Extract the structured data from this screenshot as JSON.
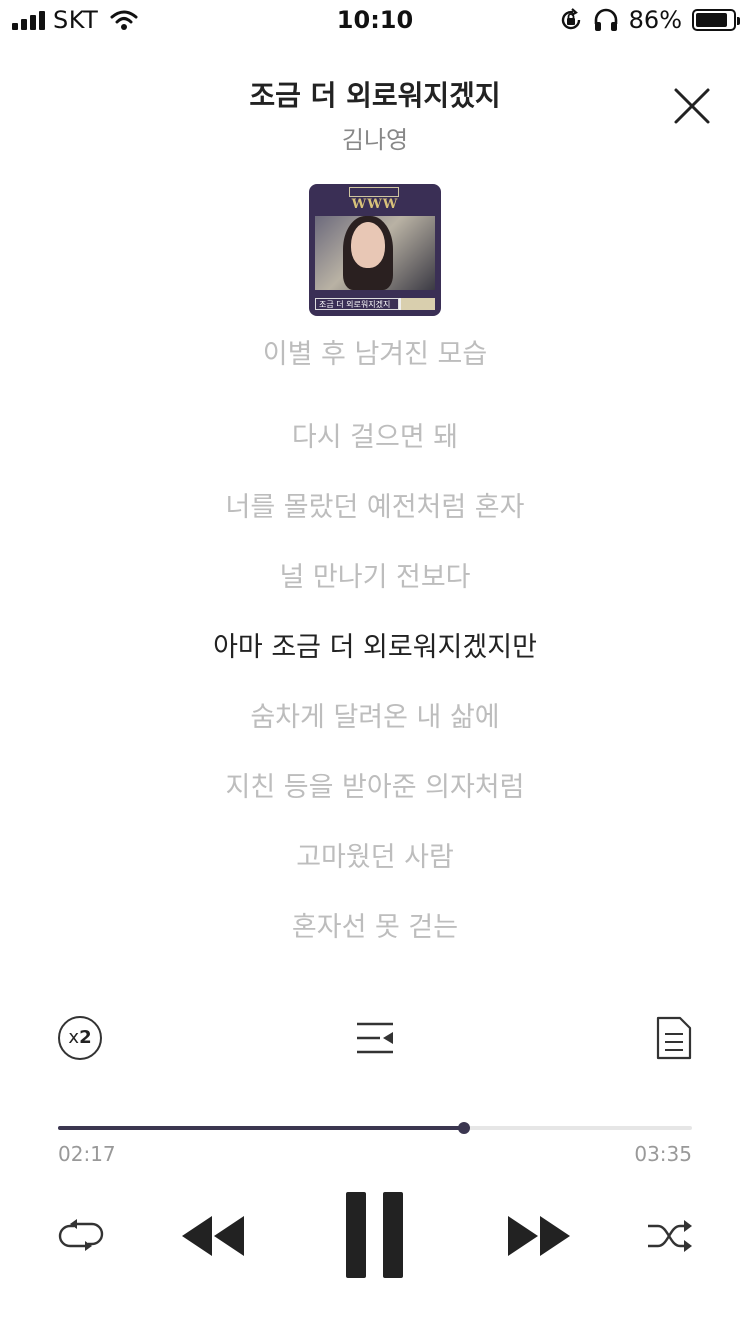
{
  "status_bar": {
    "carrier": "SKT",
    "time": "10:10",
    "battery_percent": "86%",
    "battery_level": 0.86
  },
  "header": {
    "song_title": "조금 더 외로워지겠지",
    "artist": "김나영"
  },
  "album": {
    "logo_text": "WWW",
    "cover_title": "조금 더 외로워지겠지"
  },
  "lyrics": {
    "lines": [
      "이별 후 남겨진 모습",
      "다시 걸으면 돼",
      "너를 몰랐던 예전처럼 혼자",
      "널 만나기 전보다",
      "아마 조금 더 외로워지겠지만",
      "숨차게 달려온 내 삶에",
      "지친 등을 받아준 의자처럼",
      "고마웠던 사람",
      "혼자선 못 걷는"
    ],
    "current_index": 4
  },
  "tools": {
    "speed_label_x": "x",
    "speed_label_num": "2",
    "icons": [
      "speed-icon",
      "playlist-icon",
      "lyrics-document-icon"
    ]
  },
  "progress": {
    "elapsed": "02:17",
    "total": "03:35",
    "fraction": 0.64
  },
  "controls": {
    "icons": [
      "repeat-icon",
      "rewind-icon",
      "pause-icon",
      "fast-forward-icon",
      "shuffle-icon"
    ]
  },
  "colors": {
    "accent": "#3b3650",
    "inactive_lyric": "#bdbdbd",
    "active_lyric": "#222222"
  }
}
